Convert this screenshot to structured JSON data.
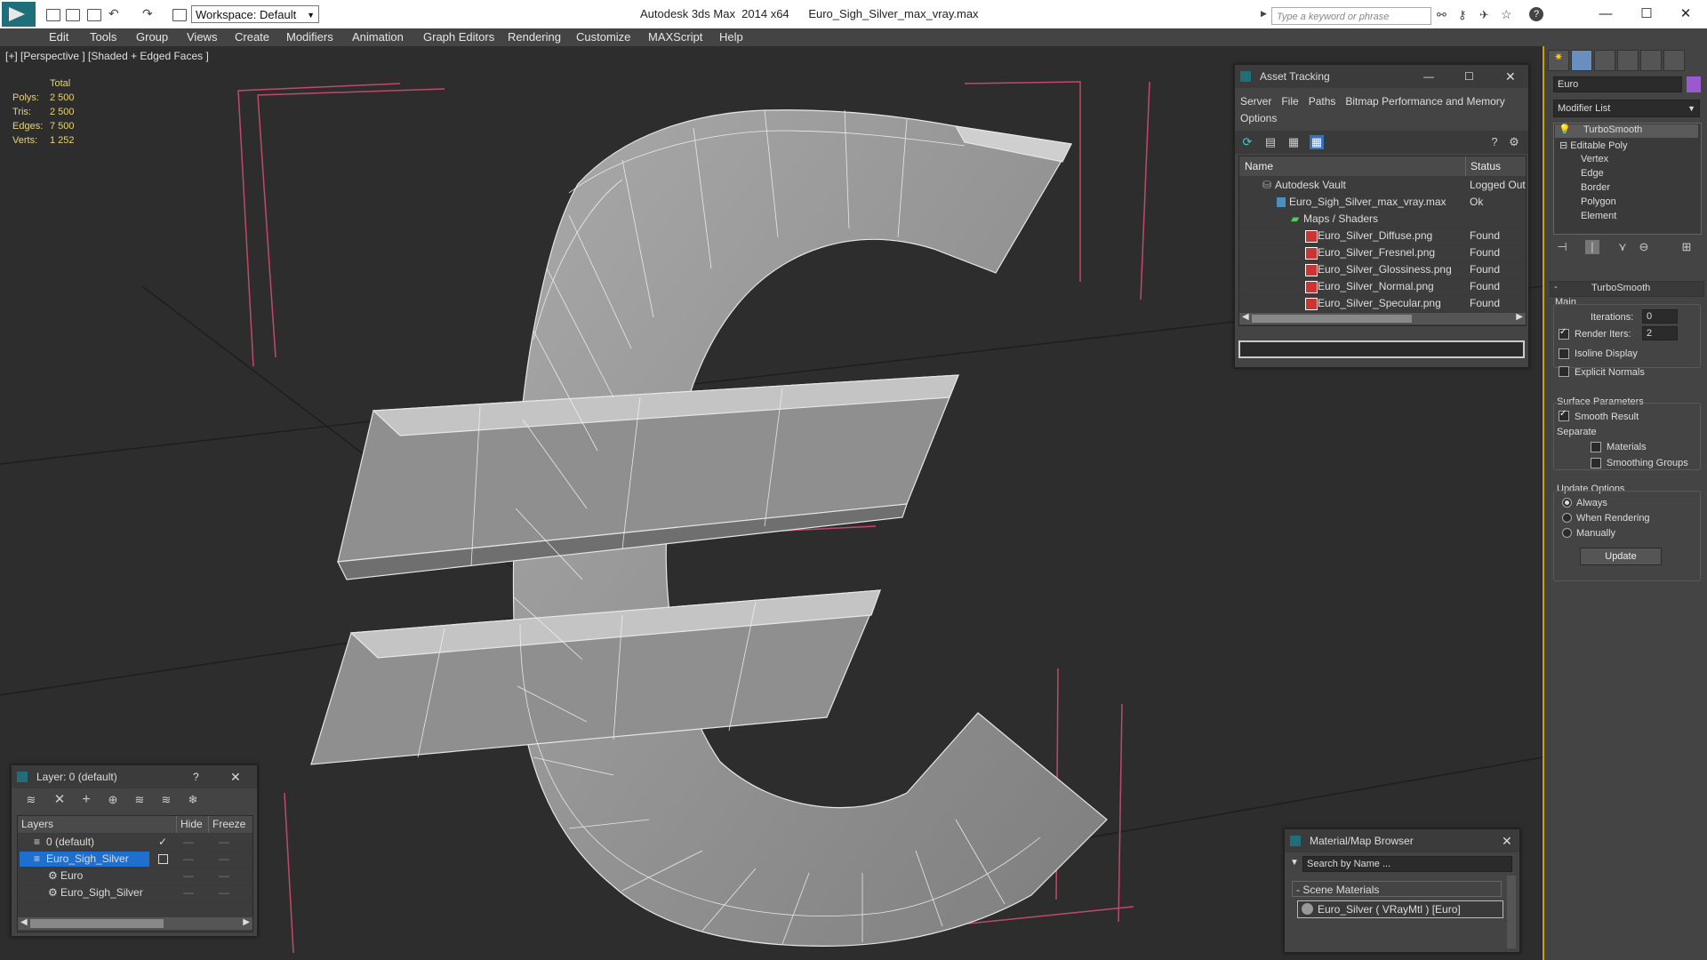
{
  "window": {
    "app_title": "Autodesk 3ds Max  2014 x64      Euro_Sigh_Silver_max_vray.max",
    "workspace": "Workspace: Default",
    "search_placeholder": "Type a keyword or phrase",
    "minimize": "—",
    "maximize": "☐",
    "close": "✕"
  },
  "menu": [
    "Edit",
    "Tools",
    "Group",
    "Views",
    "Create",
    "Modifiers",
    "Animation",
    "Graph Editors",
    "Rendering",
    "Customize",
    "MAXScript",
    "Help"
  ],
  "viewport": {
    "label": "[+] [Perspective ] [Shaded + Edged Faces ]",
    "stats": {
      "header": "Total",
      "rows": [
        {
          "label": "Polys:",
          "value": "2 500"
        },
        {
          "label": "Tris:",
          "value": "2 500"
        },
        {
          "label": "Edges:",
          "value": "7 500"
        },
        {
          "label": "Verts:",
          "value": "1 252"
        }
      ]
    }
  },
  "asset_tracking": {
    "title": "Asset Tracking",
    "menus": [
      "Server",
      "File",
      "Paths",
      "Bitmap Performance and Memory",
      "Options"
    ],
    "columns": {
      "name": "Name",
      "status": "Status"
    },
    "rows": [
      {
        "name": "Autodesk Vault",
        "status": "Logged Out",
        "indent": 0
      },
      {
        "name": "Euro_Sigh_Silver_max_vray.max",
        "status": "Ok",
        "indent": 1
      },
      {
        "name": "Maps / Shaders",
        "status": "",
        "indent": 2
      },
      {
        "name": "Euro_Silver_Diffuse.png",
        "status": "Found",
        "indent": 3
      },
      {
        "name": "Euro_Silver_Fresnel.png",
        "status": "Found",
        "indent": 3
      },
      {
        "name": "Euro_Silver_Glossiness.png",
        "status": "Found",
        "indent": 3
      },
      {
        "name": "Euro_Silver_Normal.png",
        "status": "Found",
        "indent": 3
      },
      {
        "name": "Euro_Silver_Specular.png",
        "status": "Found",
        "indent": 3
      }
    ]
  },
  "layer_panel": {
    "title": "Layer: 0 (default)",
    "help": "?",
    "columns": {
      "layers": "Layers",
      "hide": "Hide",
      "freeze": "Freeze"
    },
    "rows": [
      {
        "name": "0 (default)",
        "selected": false
      },
      {
        "name": "Euro_Sigh_Silver",
        "selected": true
      },
      {
        "name": "Euro",
        "selected": false
      },
      {
        "name": "Euro_Sigh_Silver",
        "selected": false
      }
    ]
  },
  "material_browser": {
    "title": "Material/Map Browser",
    "search_placeholder": "Search by Name ...",
    "section": "- Scene Materials",
    "item": "Euro_Silver  ( VRayMtl ) [Euro]"
  },
  "command_panel": {
    "object_name": "Euro",
    "object_color": "#9b59d0",
    "modifier_list": "Modifier List",
    "stack": [
      "TurboSmooth",
      "Editable Poly",
      "Vertex",
      "Edge",
      "Border",
      "Polygon",
      "Element"
    ],
    "rollout_title": "TurboSmooth",
    "main_label": "Main",
    "iterations_label": "Iterations:",
    "iterations_value": "0",
    "render_iters_label": "Render Iters:",
    "render_iters_value": "2",
    "isoline": "Isoline Display",
    "explicit_normals": "Explicit Normals",
    "surface_params": "Surface Parameters",
    "smooth_result": "Smooth Result",
    "separate": "Separate",
    "materials": "Materials",
    "smoothing_groups": "Smoothing Groups",
    "update_options": "Update Options",
    "always": "Always",
    "when_rendering": "When Rendering",
    "manually": "Manually",
    "update_button": "Update"
  }
}
